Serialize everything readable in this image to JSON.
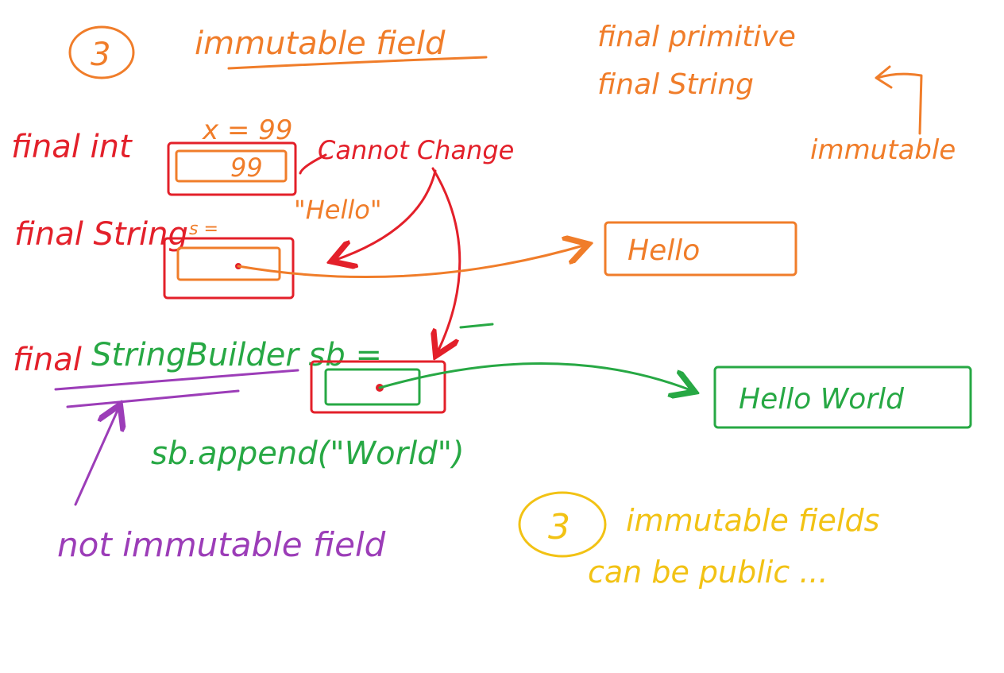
{
  "section_number": "3",
  "section_title": "immutable field",
  "note_line_1": "final primitive",
  "note_line_2": "final String",
  "note_immutable": "immutable",
  "int_decl": "final int",
  "int_assign": "x = 99",
  "int_box_value": "99",
  "string_decl": "final String",
  "string_assign": "s =",
  "cannot_change": "Cannot Change",
  "hello_literal": "\"Hello\"",
  "hello_object": "Hello",
  "sb_decl_final": "final",
  "sb_decl_type": "StringBuilder sb =",
  "sb_append": "sb.append(\"World\")",
  "hello_world_object": "Hello World",
  "not_immutable_note": "not immutable field",
  "public_number": "3",
  "public_line_1": "immutable fields",
  "public_line_2": "can be public ...",
  "colors": {
    "orange": "#f07d2a",
    "red": "#e3202a",
    "green": "#27a844",
    "purple": "#9c3db8",
    "yellow": "#f2c214"
  }
}
